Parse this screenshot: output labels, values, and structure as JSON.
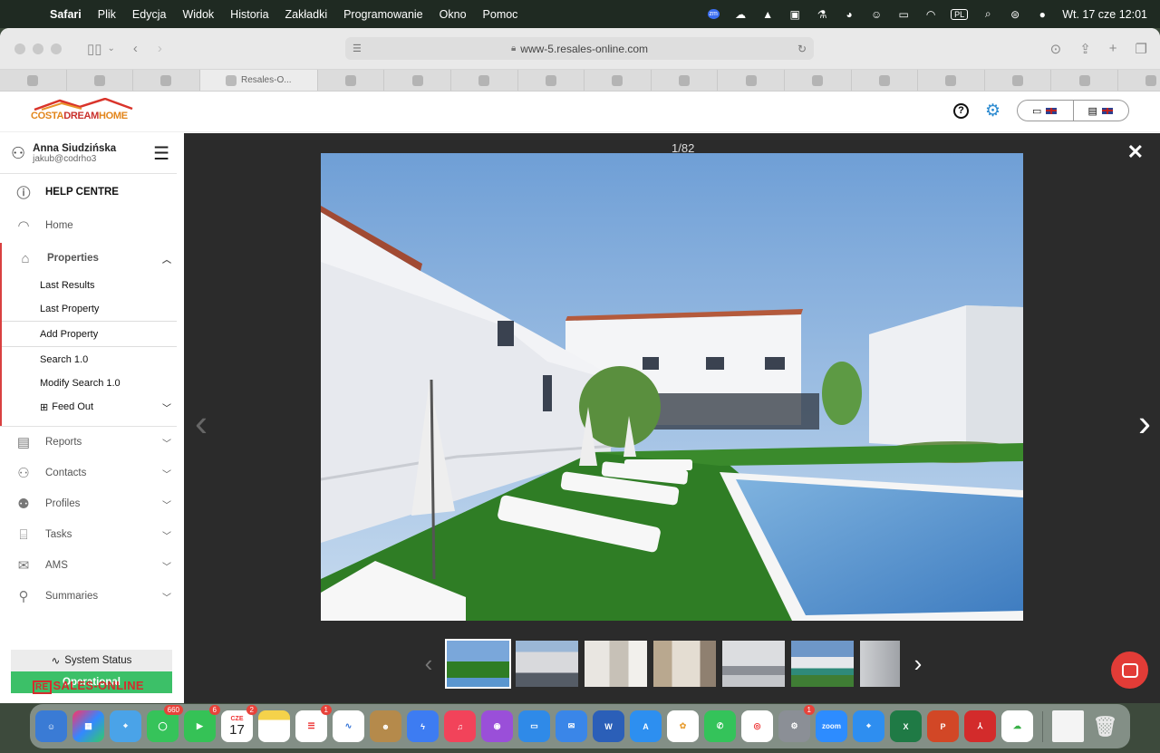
{
  "menubar": {
    "app": "Safari",
    "items": [
      "Plik",
      "Edycja",
      "Widok",
      "Historia",
      "Zakładki",
      "Programowanie",
      "Okno",
      "Pomoc"
    ],
    "zoom_icon": "zm",
    "input_lang": "PL",
    "datetime": "Wt. 17 cze  12:01"
  },
  "browser": {
    "url": "www-5.resales-online.com",
    "active_tab": "Resales-O..."
  },
  "site": {
    "logo_part1": "COSTA",
    "logo_part2": "DREAM",
    "logo_part3": "HOME"
  },
  "user": {
    "name": "Anna Siudzińska",
    "email": "jakub@codrho3"
  },
  "nav": {
    "help": "HELP CENTRE",
    "home": "Home",
    "properties": "Properties",
    "sub": {
      "last_results": "Last Results",
      "last_property": "Last Property",
      "add_property": "Add Property",
      "search": "Search 1.0",
      "modify_search": "Modify Search 1.0",
      "feed_out": "Feed Out"
    },
    "reports": "Reports",
    "contacts": "Contacts",
    "profiles": "Profiles",
    "tasks": "Tasks",
    "ams": "AMS",
    "summaries": "Summaries"
  },
  "status": {
    "label": "System Status",
    "value": "Operational",
    "value_color": "#3cc068"
  },
  "footer_logo": {
    "prefix": "RE",
    "text": "SALES-ONLINE"
  },
  "gallery": {
    "counter": "1/82",
    "thumbnail_count_visible": 7
  },
  "dock": {
    "messages_badge": "660",
    "facetime_badge": "6",
    "calendar_month": "CZE",
    "calendar_day": "17",
    "calendar_badge": "2",
    "reminders_badge": "1",
    "settings_badge": "1",
    "zoom_label": "zoom"
  }
}
